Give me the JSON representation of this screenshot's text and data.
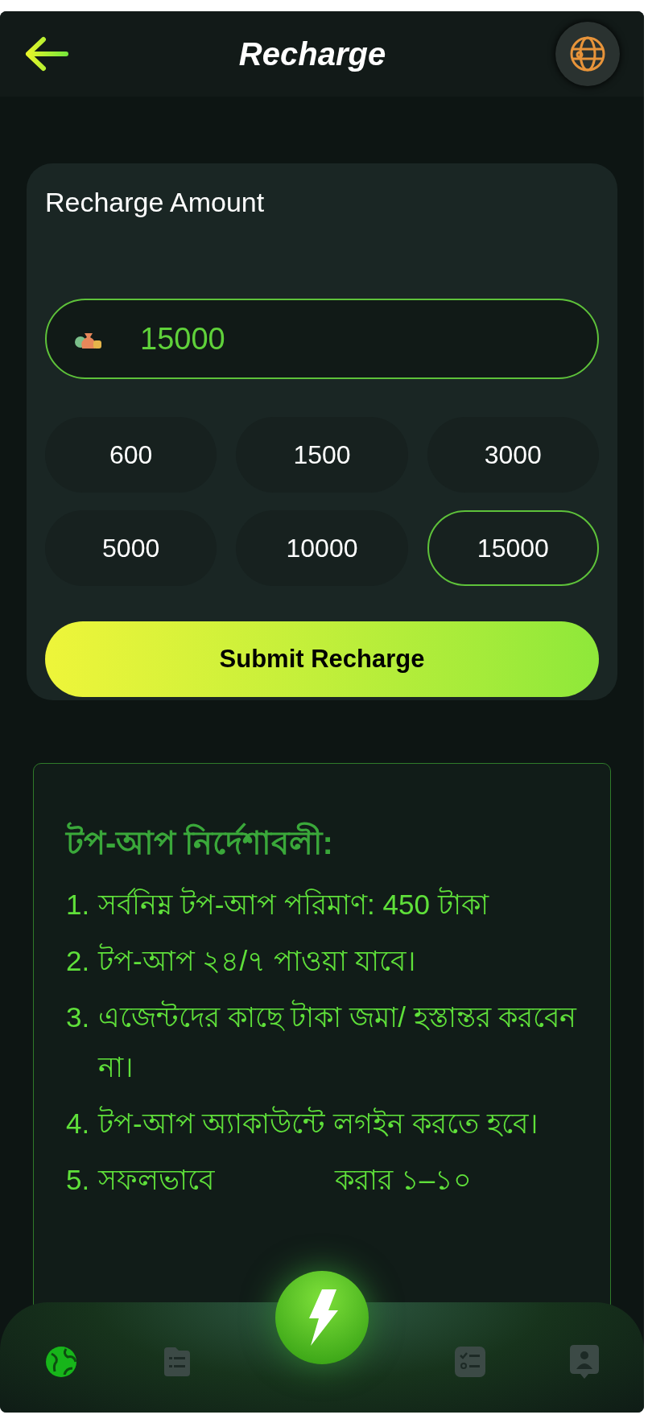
{
  "header": {
    "title": "Recharge"
  },
  "amount_card": {
    "title": "Recharge Amount",
    "input": {
      "value": "15000"
    },
    "options": [
      {
        "label": "600",
        "selected": false
      },
      {
        "label": "1500",
        "selected": false
      },
      {
        "label": "3000",
        "selected": false
      },
      {
        "label": "5000",
        "selected": false
      },
      {
        "label": "10000",
        "selected": false
      },
      {
        "label": "15000",
        "selected": true
      }
    ],
    "submit": "Submit Recharge"
  },
  "instructions": {
    "title": "টপ-আপ নির্দেশাবলী:",
    "items": [
      {
        "number": "1.",
        "parts": [
          "সর্বনিম্ন টপ-আপ পরিমাণ: 450 টাকা"
        ]
      },
      {
        "number": "2.",
        "parts": [
          "টপ-আপ ২৪/৭ পাওয়া যাবে।"
        ]
      },
      {
        "number": "3.",
        "parts": [
          "এজেন্টদের কাছে টাকা জমা/ হস্তান্তর করবেন না।"
        ]
      },
      {
        "number": "4.",
        "parts": [
          "টপ-আপ অ্যাকাউন্টে লগইন করতে হবে।"
        ]
      },
      {
        "number": "5.",
        "parts": [
          "সফলভাবে",
          "করার ১–১০"
        ]
      }
    ]
  },
  "bottom_nav": {
    "items": [
      {
        "kind": "globe",
        "selected": true
      },
      {
        "kind": "list",
        "selected": false
      },
      {
        "kind": "center",
        "selected": false
      },
      {
        "kind": "checklist",
        "selected": false
      },
      {
        "kind": "profile",
        "selected": false
      }
    ]
  }
}
